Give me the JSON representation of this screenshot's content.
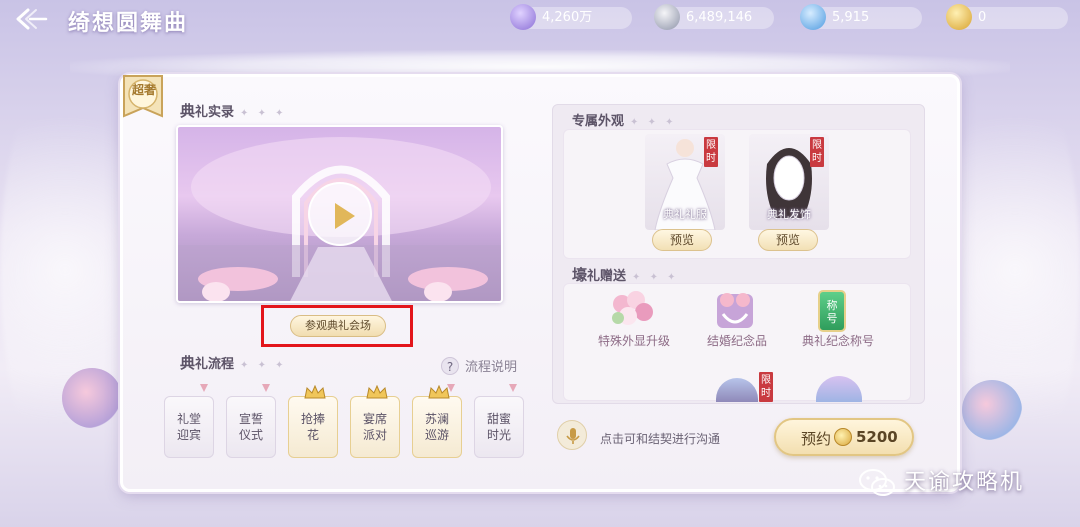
{
  "header": {
    "title": "绮想圆舞曲",
    "currencies": [
      {
        "name": "feather-crystal-icon",
        "value": "4,260万",
        "color": "#8b6fd6"
      },
      {
        "name": "silver-coin-icon",
        "value": "6,489,146",
        "color": "#9aa0b4"
      },
      {
        "name": "blue-diamond-icon",
        "value": "5,915",
        "color": "#57a9e8"
      },
      {
        "name": "gold-ring-icon",
        "value": "0",
        "color": "#e7b83b"
      }
    ]
  },
  "badge": {
    "text": "超奢"
  },
  "ceremony_record": {
    "title_big": "典",
    "title_rest": "礼实录",
    "visit_button": "参观典礼会场"
  },
  "ceremony_process": {
    "title_big": "典",
    "title_rest": "礼流程",
    "help_text": "流程说明",
    "steps": [
      {
        "label": "礼堂迎宾",
        "crown": false
      },
      {
        "label": "宣誓仪式",
        "crown": false
      },
      {
        "label": "抢捧花",
        "crown": true
      },
      {
        "label": "宴席派对",
        "crown": true
      },
      {
        "label": "苏澜巡游",
        "crown": true
      },
      {
        "label": "甜蜜时光",
        "crown": false
      }
    ]
  },
  "exclusive_look": {
    "title": "专属外观",
    "items": [
      {
        "label": "典礼礼服",
        "badge": "限时",
        "preview": "预览"
      },
      {
        "label": "典礼发饰",
        "badge": "限时",
        "preview": "预览"
      }
    ]
  },
  "gifts": {
    "title_big": "壕",
    "title_rest": "礼赠送",
    "items": [
      {
        "label": "特殊外显升级"
      },
      {
        "label": "结婚纪念品"
      },
      {
        "label": "典礼纪念称号",
        "tag": "称号"
      }
    ],
    "extra_badge": "限时"
  },
  "footer": {
    "hint": "点击可和结契进行沟通",
    "reserve_label": "预约",
    "reserve_price": "5200"
  },
  "watermark": "天谕攻略机"
}
